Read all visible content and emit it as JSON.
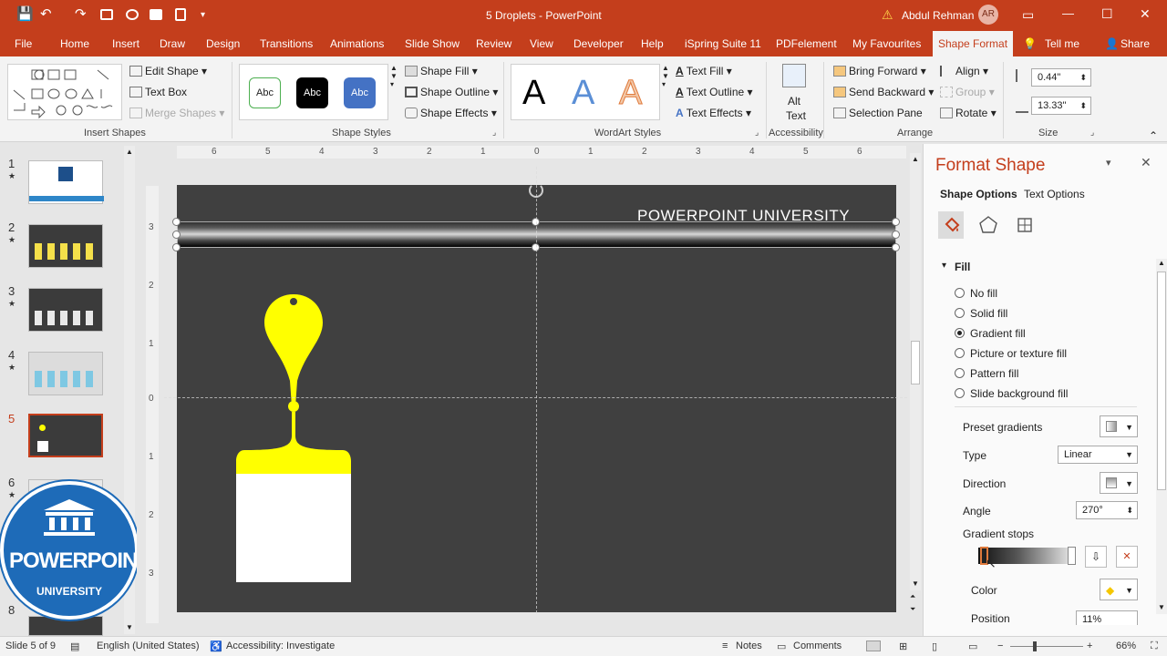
{
  "titlebar": {
    "doc_title": "5 Droplets  -  PowerPoint",
    "user_name": "Abdul Rehman",
    "user_initials": "AR",
    "warn_glyph": "⚠",
    "qa": {
      "save": "💾",
      "undo": "↶",
      "redo": "↷"
    },
    "win": {
      "display": "▭",
      "minimize": "—",
      "maximize": "☐",
      "close": "✕"
    }
  },
  "tabs": [
    {
      "label": "File"
    },
    {
      "label": "Home"
    },
    {
      "label": "Insert"
    },
    {
      "label": "Draw"
    },
    {
      "label": "Design"
    },
    {
      "label": "Transitions"
    },
    {
      "label": "Animations"
    },
    {
      "label": "Slide Show"
    },
    {
      "label": "Review"
    },
    {
      "label": "View"
    },
    {
      "label": "Developer"
    },
    {
      "label": "Help"
    },
    {
      "label": "iSpring Suite 11"
    },
    {
      "label": "PDFelement"
    },
    {
      "label": "My Favourites"
    },
    {
      "label": "Shape Format"
    }
  ],
  "tellme": "Tell me",
  "share": "Share",
  "ribbon": {
    "insert_shapes": {
      "edit_shape": "Edit Shape",
      "text_box": "Text Box",
      "merge_shapes": "Merge Shapes",
      "label": "Insert Shapes"
    },
    "shape_styles": {
      "sample": "Abc",
      "shape_fill": "Shape Fill",
      "shape_outline": "Shape Outline",
      "shape_effects": "Shape Effects",
      "label": "Shape Styles"
    },
    "wordart": {
      "letter": "A",
      "text_fill": "Text Fill",
      "text_outline": "Text Outline",
      "text_effects": "Text Effects",
      "label": "WordArt Styles"
    },
    "accessibility": {
      "alt_text_1": "Alt",
      "alt_text_2": "Text",
      "label": "Accessibility"
    },
    "arrange": {
      "bring_forward": "Bring Forward",
      "send_backward": "Send Backward",
      "selection_pane": "Selection Pane",
      "align": "Align",
      "group": "Group",
      "rotate": "Rotate",
      "label": "Arrange"
    },
    "size": {
      "height": "0.44\"",
      "width": "13.33\"",
      "label": "Size"
    }
  },
  "slides": [
    {
      "num": "1",
      "star": "★"
    },
    {
      "num": "2",
      "star": "★"
    },
    {
      "num": "3",
      "star": "★"
    },
    {
      "num": "4",
      "star": "★"
    },
    {
      "num": "5"
    },
    {
      "num": "6",
      "star": "★"
    },
    {
      "num": "8"
    }
  ],
  "ruler": {
    "h": [
      "6",
      "5",
      "4",
      "3",
      "2",
      "1",
      "0",
      "1",
      "2",
      "3",
      "4",
      "5",
      "6"
    ],
    "v": [
      "3",
      "2",
      "1",
      "0",
      "1",
      "2",
      "3"
    ]
  },
  "slide": {
    "banner_text": "POWERPOINT UNIVERSITY",
    "accent": "#ffff00",
    "bg": "#404040"
  },
  "logo": {
    "line1": "POWERPOINT",
    "line2": "UNIVERSITY"
  },
  "format_shape": {
    "title": "Format Shape",
    "tab_shape": "Shape Options",
    "tab_text": "Text Options",
    "fill_header": "Fill",
    "options": [
      {
        "label": "No fill",
        "selected": false
      },
      {
        "label": "Solid fill",
        "selected": false
      },
      {
        "label": "Gradient fill",
        "selected": true
      },
      {
        "label": "Picture or texture fill",
        "selected": false
      },
      {
        "label": "Pattern fill",
        "selected": false
      },
      {
        "label": "Slide background fill",
        "selected": false
      }
    ],
    "preset_gradients": "Preset gradients",
    "type_label": "Type",
    "type_value": "Linear",
    "direction_label": "Direction",
    "angle_label": "Angle",
    "angle_value": "270°",
    "gradient_stops": "Gradient stops",
    "color_label": "Color",
    "position_label": "Position",
    "position_value": "11%"
  },
  "status": {
    "slide_of": "Slide 5 of 9",
    "language": "English (United States)",
    "accessibility": "Accessibility: Investigate",
    "notes": "Notes",
    "comments": "Comments",
    "zoom": "66%"
  }
}
